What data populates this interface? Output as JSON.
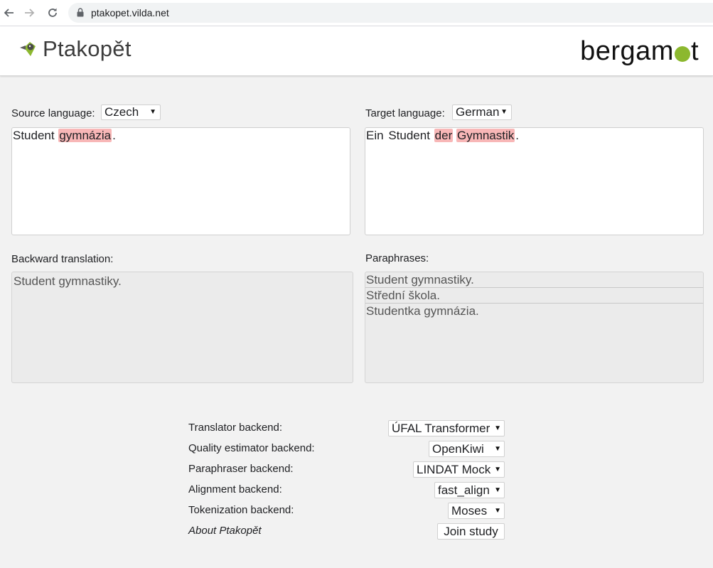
{
  "browser": {
    "url": "ptakopet.vilda.net",
    "back_icon": "arrow-left-icon",
    "forward_icon": "arrow-right-icon",
    "reload_icon": "reload-icon"
  },
  "header": {
    "brand": "Ptakopět",
    "partner": "bergamot",
    "accent_color": "#8cb82f"
  },
  "source": {
    "label": "Source language:",
    "language": "Czech",
    "tokens": [
      {
        "text": "Student",
        "highlight": false
      },
      {
        "text": "gymnázia",
        "highlight": true
      },
      {
        "text": ".",
        "highlight": false
      }
    ]
  },
  "target": {
    "label": "Target language:",
    "language": "German",
    "tokens": [
      {
        "text": "Ein",
        "highlight": false
      },
      {
        "text": "Student",
        "highlight": false
      },
      {
        "text": "der",
        "highlight": true
      },
      {
        "text": "Gymnastik",
        "highlight": true
      },
      {
        "text": ".",
        "highlight": false
      }
    ]
  },
  "backward": {
    "label": "Backward translation:",
    "text": "Student gymnastiky."
  },
  "paraphrases": {
    "label": "Paraphrases:",
    "items": [
      "Student gymnastiky.",
      "Střední škola.",
      "Studentka gymnázia."
    ]
  },
  "settings": {
    "translator": {
      "label": "Translator backend:",
      "value": "ÚFAL Transformer"
    },
    "quality": {
      "label": "Quality estimator backend:",
      "value": "OpenKiwi"
    },
    "paraphraser": {
      "label": "Paraphraser backend:",
      "value": "LINDAT Mock"
    },
    "alignment": {
      "label": "Alignment backend:",
      "value": "fast_align"
    },
    "tokenization": {
      "label": "Tokenization backend:",
      "value": "Moses"
    },
    "about": "About Ptakopět",
    "join": "Join study"
  },
  "highlight_color": "#f8b7b7"
}
